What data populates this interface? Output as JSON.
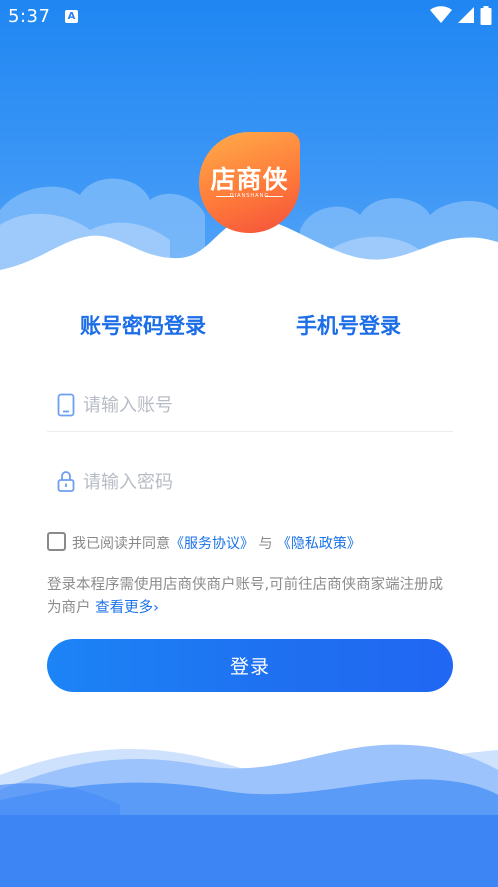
{
  "status_bar": {
    "time": "5:37",
    "notification_icon_letter": "A",
    "icons": [
      "wifi-icon",
      "signal-icon",
      "battery-icon"
    ]
  },
  "logo": {
    "text": "店商侠",
    "subtext": "DIANSHANG"
  },
  "tabs": {
    "account_login": "账号密码登录",
    "phone_login": "手机号登录"
  },
  "form": {
    "account_placeholder": "请输入账号",
    "password_placeholder": "请输入密码"
  },
  "agreement": {
    "prefix": "我已阅读并同意",
    "service_link": "《服务协议》",
    "and": "与",
    "privacy_link": "《隐私政策》"
  },
  "notice": {
    "text": "登录本程序需使用店商侠商户账号,可前往店商侠商家端注册成为商户",
    "more_link": "查看更多›"
  },
  "login_button": "登录",
  "colors": {
    "primary": "#1b6de8",
    "hero_top": "#2a86f4",
    "logo_orange": "#ff7b3a",
    "button": "#1f74f2"
  }
}
